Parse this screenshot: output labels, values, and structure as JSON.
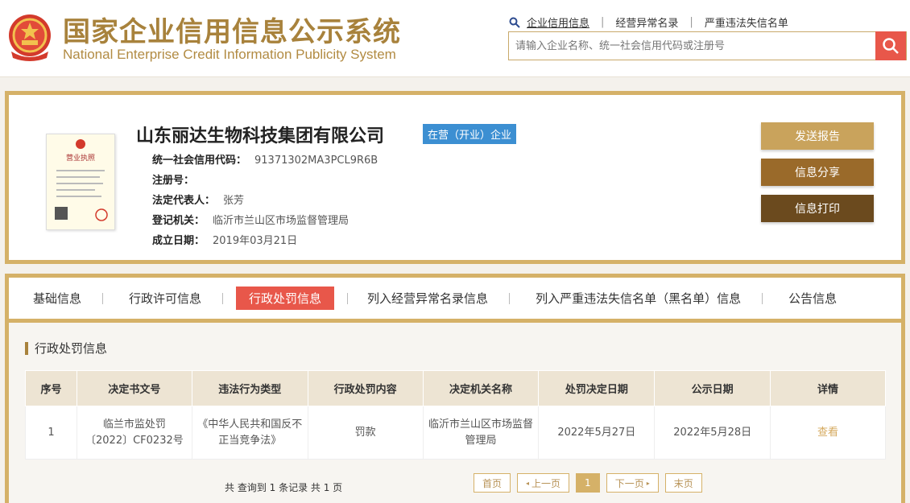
{
  "header": {
    "title_cn": "国家企业信用信息公示系统",
    "title_en": "National Enterprise Credit Information Publicity System",
    "nav": [
      "企业信用信息",
      "经营异常名录",
      "严重违法失信名单"
    ],
    "search_placeholder": "请输入企业名称、统一社会信用代码或注册号"
  },
  "company": {
    "name": "山东丽达生物科技集团有限公司",
    "status": "在营（开业）企业",
    "fields": [
      {
        "label": "统一社会信用代码：",
        "value": "91371302MA3PCL9R6B"
      },
      {
        "label": "注册号：",
        "value": ""
      },
      {
        "label": "法定代表人：",
        "value": "张芳"
      },
      {
        "label": "登记机关：",
        "value": "临沂市兰山区市场监督管理局"
      },
      {
        "label": "成立日期：",
        "value": "2019年03月21日"
      }
    ],
    "license_title": "营业执照",
    "buttons": [
      "发送报告",
      "信息分享",
      "信息打印"
    ]
  },
  "tabs": [
    "基础信息",
    "行政许可信息",
    "行政处罚信息",
    "列入经营异常名录信息",
    "列入严重违法失信名单（黑名单）信息",
    "公告信息"
  ],
  "section_title": "行政处罚信息",
  "table": {
    "headers": [
      "序号",
      "决定书文号",
      "违法行为类型",
      "行政处罚内容",
      "决定机关名称",
      "处罚决定日期",
      "公示日期",
      "详情"
    ],
    "rows": [
      [
        "1",
        "临兰市监处罚〔2022〕CF0232号",
        "《中华人民共和国反不正当竞争法》",
        "罚款",
        "临沂市兰山区市场监督管理局",
        "2022年5月27日",
        "2022年5月28日",
        "查看"
      ]
    ]
  },
  "pagination": {
    "total_text": "共 查询到 1 条记录 共 1 页",
    "first": "首页",
    "prev": "上一页",
    "current": "1",
    "next": "下一页",
    "last": "末页"
  },
  "colors": {
    "brand": "#a8823c",
    "accent_red": "#e8574a",
    "badge_blue": "#3c8fd2"
  }
}
